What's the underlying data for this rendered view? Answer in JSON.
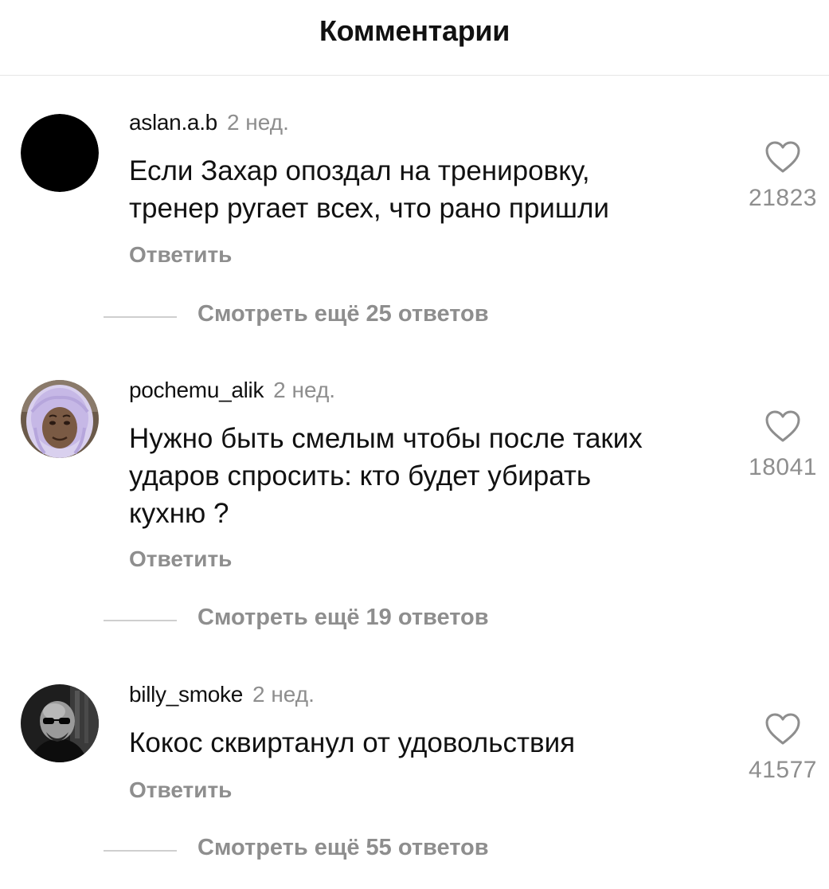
{
  "header": {
    "title": "Комментарии"
  },
  "comments": [
    {
      "username": "aslan.a.b",
      "time": "2 нед.",
      "lines": [
        "Если Захар опоздал на тренировку,",
        "тренер ругает всех, что рано пришли"
      ],
      "likes": "21823",
      "reply_label": "Ответить",
      "more_replies": "Смотреть ещё 25 ответов",
      "avatar": "black-circle"
    },
    {
      "username": "pochemu_alik",
      "time": "2 нед.",
      "lines": [
        "Нужно быть смелым чтобы после таких",
        "ударов спросить: кто будет убирать",
        "кухню ?"
      ],
      "likes": "18041",
      "reply_label": "Ответить",
      "more_replies": "Смотреть ещё 19 ответов",
      "avatar": "person-in-purple-hood"
    },
    {
      "username": "billy_smoke",
      "time": "2 нед.",
      "lines": [
        "Кокос сквиртанул от удовольствия"
      ],
      "likes": "41577",
      "reply_label": "Ответить",
      "more_replies": "Смотреть ещё 55 ответов",
      "avatar": "bald-man-sunglasses-bw"
    }
  ],
  "icons": {
    "like": "heart-outline-icon"
  },
  "colors": {
    "text": "#111111",
    "secondary": "#8e8e8e",
    "divider": "#e6e6e6",
    "reply_line": "#cfcfcf"
  }
}
